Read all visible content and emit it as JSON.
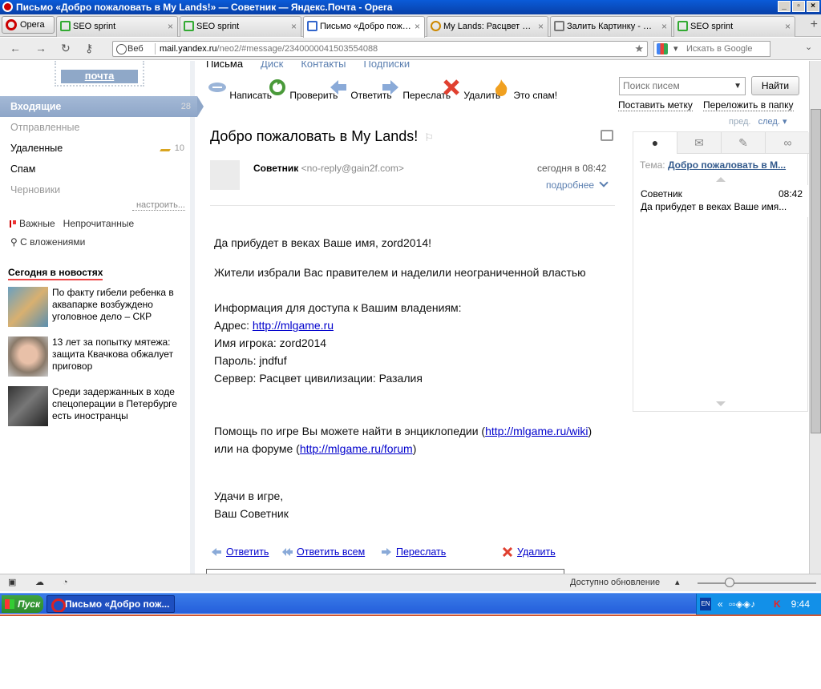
{
  "window": {
    "title": "Письмо «Добро пожаловать в My Lands!» — Советник — Яндекс.Почта - Opera"
  },
  "browser": {
    "menu_label": "Opera",
    "tabs": [
      {
        "label": "SEO sprint",
        "icon": "seo-sprint-icon"
      },
      {
        "label": "SEO sprint",
        "icon": "seo-sprint-icon"
      },
      {
        "label": "Письмо «Добро пож…",
        "icon": "mail-icon"
      },
      {
        "label": "My Lands: Расцвет …",
        "icon": "game-icon"
      },
      {
        "label": "Залить Картинку - …",
        "icon": "picture-icon"
      },
      {
        "label": "SEO sprint",
        "icon": "seo-sprint-icon"
      }
    ],
    "url_prefix": "Веб",
    "url_domain": "mail.yandex.ru",
    "url_path": "/neo2/#message/2340000041503554088",
    "search_placeholder": "Искать в Google"
  },
  "sidebar": {
    "logo": "почта",
    "folders": [
      {
        "label": "Входящие",
        "count": "28"
      },
      {
        "label": "Отправленные",
        "count": ""
      },
      {
        "label": "Удаленные",
        "count": "10"
      },
      {
        "label": "Спам",
        "count": ""
      },
      {
        "label": "Черновики",
        "count": ""
      }
    ],
    "setup": "настроить...",
    "label_important": "Важные",
    "label_unread": "Непрочитанные",
    "with_attachments": "С вложениями",
    "news_header": "Сегодня в новостях",
    "news": [
      {
        "text": "По факту гибели ребенка в аквапарке возбуждено уголовное дело – СКР"
      },
      {
        "text": "13 лет за попытку мятежа: защита Квачкова обжалует приговор"
      },
      {
        "text": "Среди задержанных в ходе спецоперации в Петербурге есть иностранцы"
      }
    ]
  },
  "main": {
    "top_tabs": [
      "Письма",
      "Диск",
      "Контакты",
      "Подписки"
    ],
    "toolbar": [
      {
        "label": "Написать",
        "icon": "compose-icon"
      },
      {
        "label": "Проверить",
        "icon": "refresh-icon"
      },
      {
        "label": "Ответить",
        "icon": "reply-icon"
      },
      {
        "label": "Переслать",
        "icon": "forward-icon"
      },
      {
        "label": "Удалить",
        "icon": "delete-icon"
      },
      {
        "label": "Это спам!",
        "icon": "spam-icon"
      }
    ],
    "subject": "Добро пожаловать в My Lands!",
    "sender_name": "Советник",
    "sender_email": "<no-reply@gain2f.com>",
    "date": "сегодня в 08:42",
    "more": "подробнее",
    "body": {
      "greeting": "Да прибудет в веках Ваше имя, zord2014!",
      "line1": "Жители избрали Вас правителем и наделили неограниченной властью",
      "info_header": "Информация для доступа к Вашим владениям:",
      "address_label": "Адрес: ",
      "address_link": "http://mlgame.ru",
      "player": "Имя игрока: zord2014",
      "password": "Пароль: jndfuf",
      "server": "Сервер: Расцвет цивилизации: Разалия",
      "help_prefix": "Помощь по игре Вы можете найти в энциклопедии (",
      "help_link1": "http://mlgame.ru/wiki",
      "help_mid": ")",
      "help_prefix2": "или на форуме (",
      "help_link2": "http://mlgame.ru/forum",
      "help_suffix": ")",
      "luck": "Удачи в игре,",
      "sign": "Ваш Советник"
    },
    "bottom_actions": {
      "reply": "Ответить",
      "reply_all": "Ответить всем",
      "forward": "Переслать",
      "delete": "Удалить"
    }
  },
  "right": {
    "search_placeholder": "Поиск писем",
    "find": "Найти",
    "set_label": "Поставить метку",
    "move_folder": "Переложить в папку",
    "prev": "пред.",
    "next": "след.",
    "tema_label": "Тема:",
    "tema_value": "Добро пожаловать в М...",
    "thread_sender": "Советник",
    "thread_time": "08:42",
    "thread_snippet": "Да прибудет в веках Ваше имя..."
  },
  "statusbar": {
    "update": "Доступно обновление"
  },
  "taskbar": {
    "start": "Пуск",
    "item": "Письмо «Добро пож...",
    "lang": "EN",
    "clock": "9:44"
  },
  "colors": {
    "accent": "#8ea6c8",
    "link": "#0000cc",
    "titlebar": "#0a5bd8",
    "taskbar": "#245edb"
  }
}
